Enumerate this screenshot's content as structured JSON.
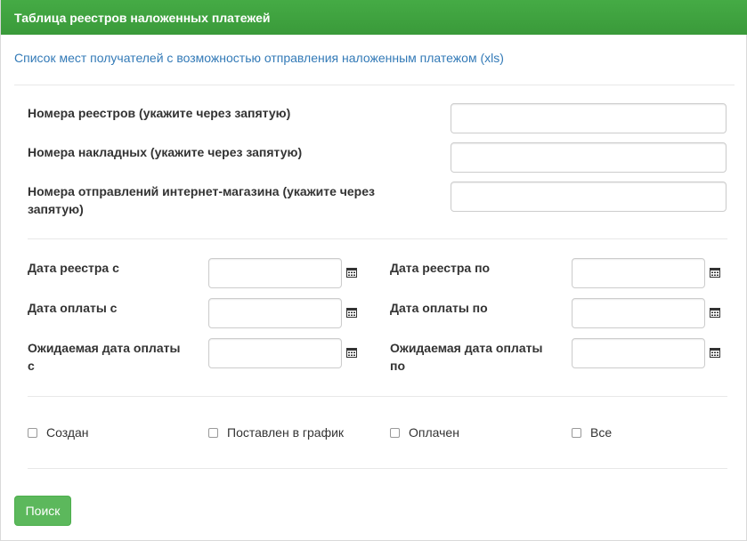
{
  "header": {
    "title": "Таблица реестров наложенных платежей"
  },
  "xls_link": "Список мест получателей с возможностью отправления наложенным платежом (xls)",
  "text_filters": [
    {
      "label": "Номера реестров (укажите через запятую)",
      "value": ""
    },
    {
      "label": "Номера накладных (укажите через запятую)",
      "value": ""
    },
    {
      "label_line1": "Номера отправлений интернет-магазина (укажите через",
      "label_line2": "запятую)",
      "value": ""
    }
  ],
  "date_filters": {
    "registry_from": {
      "label": "Дата реестра с",
      "value": ""
    },
    "registry_to": {
      "label": "Дата реестра по",
      "value": ""
    },
    "payment_from": {
      "label": "Дата оплаты с",
      "value": ""
    },
    "payment_to": {
      "label": "Дата оплаты по",
      "value": ""
    },
    "expected_from": {
      "label_line1": "Ожидаемая дата оплаты",
      "label_line2": "с",
      "value": ""
    },
    "expected_to": {
      "label_line1": "Ожидаемая дата оплаты",
      "label_line2": "по",
      "value": ""
    }
  },
  "status_checkboxes": [
    {
      "label": "Создан",
      "checked": false
    },
    {
      "label": "Поставлен в график",
      "checked": false
    },
    {
      "label": "Оплачен",
      "checked": false
    },
    {
      "label": "Все",
      "checked": false
    }
  ],
  "search_button": "Поиск",
  "icons": {
    "calendar": "calendar-icon"
  },
  "colors": {
    "header_green": "#3ea13e",
    "button_green": "#5cb85c",
    "link_blue": "#337ab7"
  }
}
